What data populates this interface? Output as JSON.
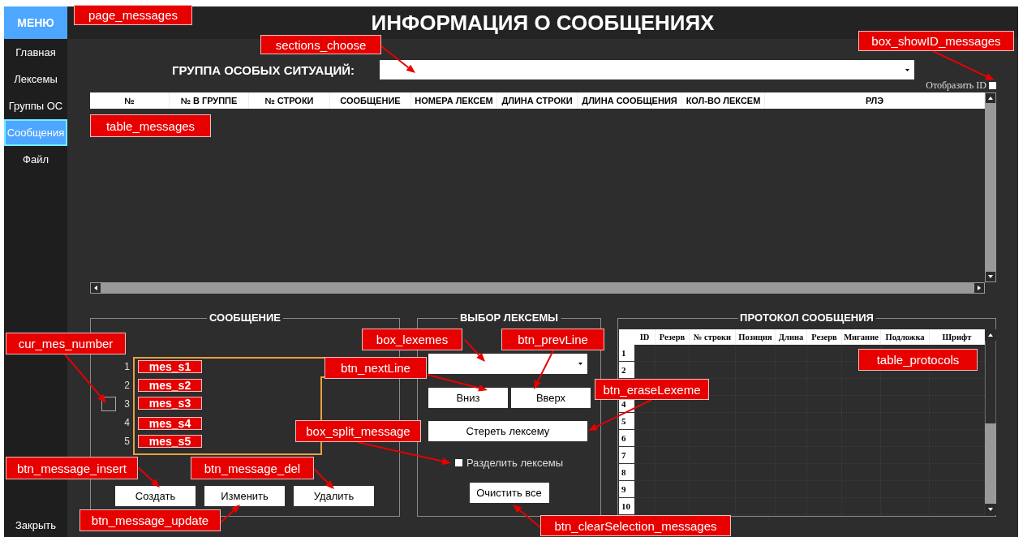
{
  "sidebar": {
    "header": "МЕНЮ",
    "items": [
      {
        "label": "Главная",
        "selected": false
      },
      {
        "label": "Лексемы",
        "selected": false
      },
      {
        "label": "Группы ОС",
        "selected": false
      },
      {
        "label": "Сообщения",
        "selected": true
      },
      {
        "label": "Файл",
        "selected": false
      }
    ],
    "footer": "Закрыть"
  },
  "title": "ИНФОРМАЦИЯ О СООБЩЕНИЯХ",
  "group_select": {
    "label": "ГРУППА ОСОБЫХ СИТУАЦИЙ:"
  },
  "show_id": {
    "label": "Отобразить ID",
    "checked": false
  },
  "messages_table": {
    "columns": [
      "№",
      "№ В ГРУППЕ",
      "№  СТРОКИ",
      "СООБЩЕНИЕ",
      "НОМЕРА ЛЕКСЕМ",
      "ДЛИНА СТРОКИ",
      "ДЛИНА СООБЩЕНИЯ",
      "КОЛ-ВО ЛЕКСЕМ",
      "РЛЭ"
    ]
  },
  "message_panel": {
    "title": "СООБЩЕНИЕ",
    "lines": [
      {
        "number": "1",
        "current": false
      },
      {
        "number": "2",
        "current": false
      },
      {
        "number": "3",
        "current": true
      },
      {
        "number": "4",
        "current": false
      },
      {
        "number": "5",
        "current": false
      }
    ],
    "buttons": [
      "Создать",
      "Изменить",
      "Удалить"
    ]
  },
  "lexeme_panel": {
    "title": "ВЫБОР ЛЕКСЕМЫ",
    "nav_buttons": [
      "Вниз",
      "Вверх"
    ],
    "erase_button": "Стереть лексему",
    "split": {
      "label": "Разделить лексемы",
      "checked": false
    },
    "clear_button": "Очистить все"
  },
  "protocol_panel": {
    "title": "ПРОТОКОЛ СООБЩЕНИЯ",
    "columns": [
      "ID",
      "Резерв",
      "№ строки",
      "Позиция",
      "Длина",
      "Резерв",
      "Мигание",
      "Подложка",
      "Шрифт"
    ],
    "rows": [
      {
        "number": "1"
      },
      {
        "number": "2"
      },
      {},
      {
        "number": "4"
      },
      {
        "number": "5"
      },
      {
        "number": "6"
      },
      {
        "number": "7"
      },
      {
        "number": "8"
      },
      {
        "number": "9"
      },
      {
        "number": "10"
      }
    ]
  },
  "annotations": [
    {
      "label": "page_messages"
    },
    {
      "label": "sections_choose"
    },
    {
      "label": "box_showID_messages"
    },
    {
      "label": "table_messages"
    },
    {
      "label": "cur_mes_number"
    },
    {
      "label": "mes_s1"
    },
    {
      "label": "mes_s2"
    },
    {
      "label": "mes_s3"
    },
    {
      "label": "mes_s4"
    },
    {
      "label": "mes_s5"
    },
    {
      "label": "box_lexemes"
    },
    {
      "label": "btn_prevLine"
    },
    {
      "label": "btn_nextLine"
    },
    {
      "label": "btn_eraseLexeme"
    },
    {
      "label": "box_split_message"
    },
    {
      "label": "btn_message_insert"
    },
    {
      "label": "btn_message_del"
    },
    {
      "label": "btn_message_update"
    },
    {
      "label": "btn_clearSelection_messages"
    },
    {
      "label": "table_protocols"
    }
  ]
}
